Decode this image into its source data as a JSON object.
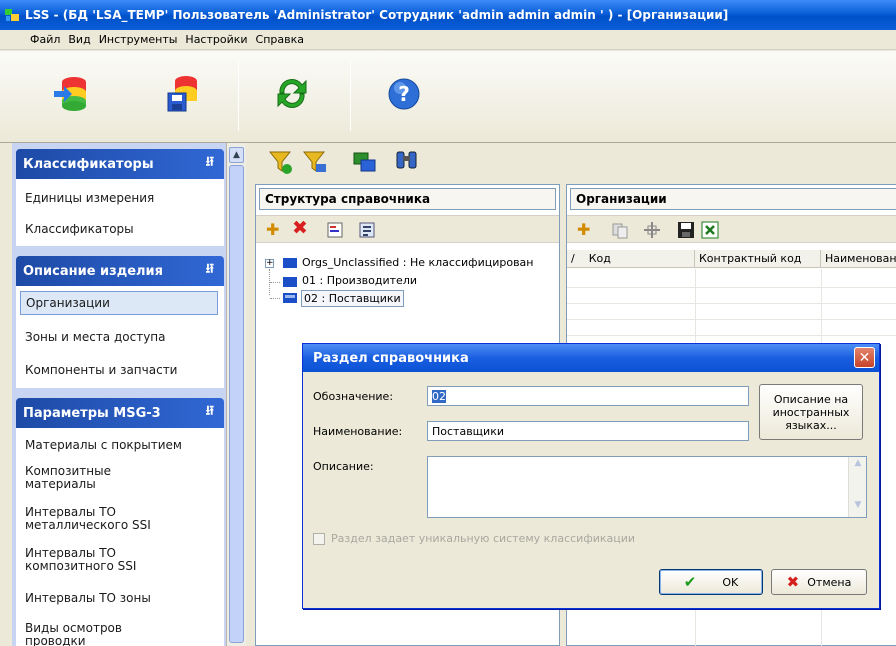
{
  "window": {
    "title": "LSS - (БД 'LSA_TEMP' Пользователь 'Administrator' Сотрудник 'admin admin admin ' ) - [Организации]"
  },
  "menu": [
    "Файл",
    "Вид",
    "Инструменты",
    "Настройки",
    "Справка"
  ],
  "nav": {
    "groups": [
      {
        "title": "Классификаторы",
        "items": [
          "Единицы измерения",
          "Классификаторы"
        ]
      },
      {
        "title": "Описание изделия",
        "items": [
          "Организации",
          "Зоны и места доступа",
          "Компоненты и запчасти"
        ]
      },
      {
        "title": "Параметры MSG-3",
        "items": [
          "Материалы с покрытием",
          "Композитные материалы",
          "Интервалы ТО металлического SSI",
          "Интервалы ТО композитного SSI",
          "Интервалы ТО зоны",
          "Виды осмотров проводки"
        ]
      }
    ]
  },
  "structure": {
    "title": "Структура справочника",
    "tree": [
      "Orgs_Unclassified : Не классифицирован",
      "01 : Производители",
      "02 : Поставщики"
    ]
  },
  "orgs": {
    "title": "Организации",
    "columns": [
      "Код",
      "Контрактный код",
      "Наименован"
    ]
  },
  "dialog": {
    "title": "Раздел справочника",
    "code_label": "Обозначение:",
    "code_value": "02",
    "name_label": "Наименование:",
    "name_value": "Поставщики",
    "desc_label": "Описание:",
    "desc_value": "",
    "lang_button": "Описание на иностранных языках...",
    "unique_checkbox": "Раздел задает уникальную систему классификации",
    "ok_button": "OK",
    "cancel_button": "Отмена"
  }
}
